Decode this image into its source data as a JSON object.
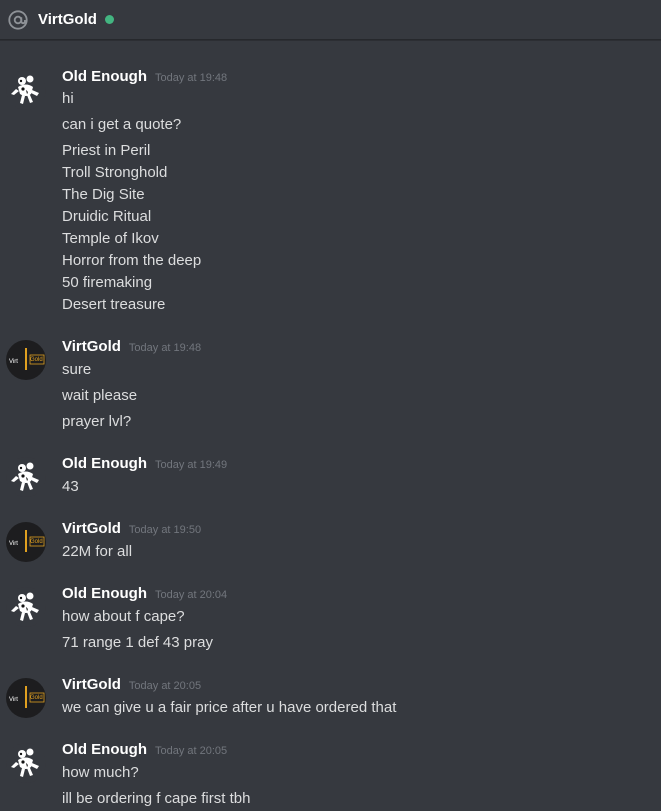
{
  "header": {
    "channel": "VirtGold",
    "status_color": "#43b581"
  },
  "messages": [
    {
      "author": "Old Enough",
      "timestamp": "Today at 19:48",
      "avatar": "old-enough-avatar",
      "lines": [
        "hi",
        "can i get a quote?",
        "Priest in Peril",
        "Troll Stronghold",
        "The Dig Site",
        "Druidic Ritual",
        "Temple of Ikov",
        "Horror from the deep",
        "50 firemaking",
        "Desert treasure"
      ]
    },
    {
      "author": "VirtGold",
      "timestamp": "Today at 19:48",
      "avatar": "virtgold-avatar",
      "lines": [
        "sure",
        "wait please",
        "prayer lvl?"
      ]
    },
    {
      "author": "Old Enough",
      "timestamp": "Today at 19:49",
      "avatar": "old-enough-avatar",
      "lines": [
        "43"
      ]
    },
    {
      "author": "VirtGold",
      "timestamp": "Today at 19:50",
      "avatar": "virtgold-avatar",
      "lines": [
        "22M for all"
      ]
    },
    {
      "author": "Old Enough",
      "timestamp": "Today at 20:04",
      "avatar": "old-enough-avatar",
      "lines": [
        "how about f cape?",
        "71 range 1 def 43 pray"
      ]
    },
    {
      "author": "VirtGold",
      "timestamp": "Today at 20:05",
      "avatar": "virtgold-avatar",
      "lines": [
        "we can give u a fair price after u have ordered that"
      ]
    },
    {
      "author": "Old Enough",
      "timestamp": "Today at 20:05",
      "avatar": "old-enough-avatar",
      "lines": [
        "how much?",
        "ill be ordering f cape first tbh"
      ]
    }
  ]
}
